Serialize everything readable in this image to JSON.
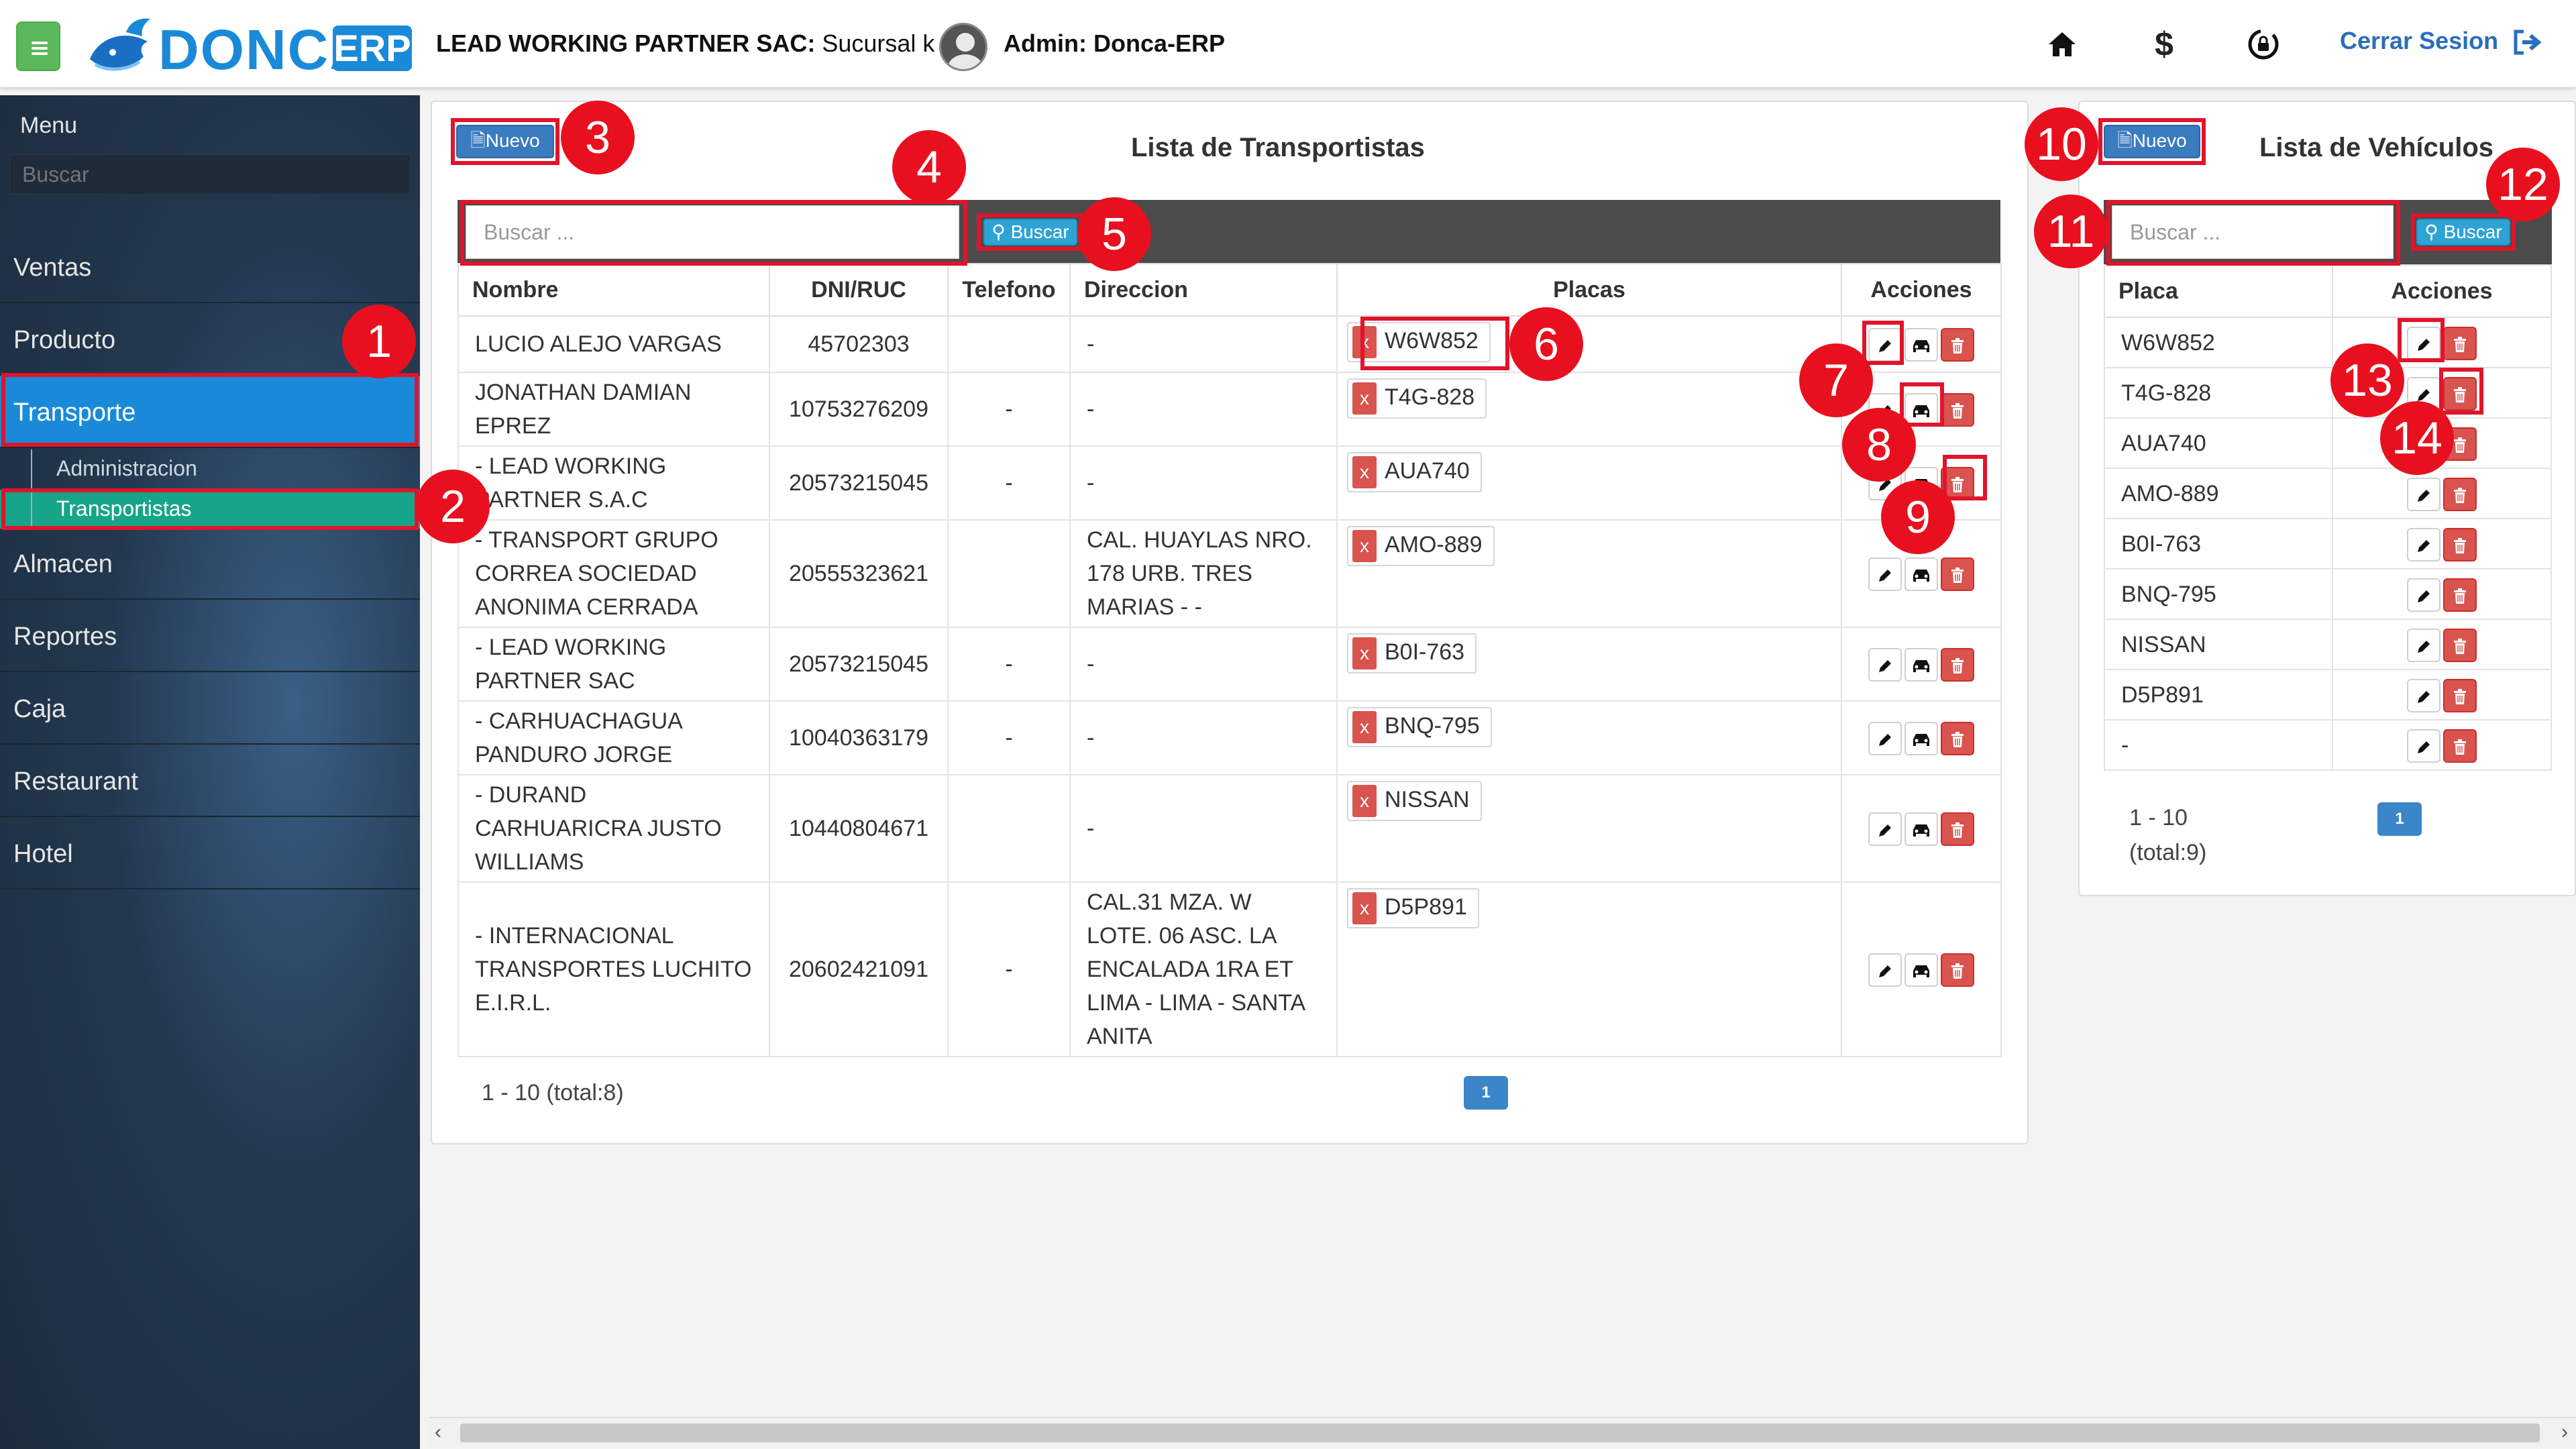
{
  "header": {
    "logo_word": "DONCA",
    "logo_badge": "ERP",
    "company_bold": "LEAD WORKING PARTNER SAC:",
    "company_rest": " Sucursal k |",
    "admin": "Admin: Donca-ERP",
    "logout": "Cerrar Sesion"
  },
  "sidebar": {
    "title": "Menu",
    "search_placeholder": "Buscar",
    "items": [
      "Ventas",
      "Producto",
      "Transporte",
      "Almacen",
      "Reportes",
      "Caja",
      "Restaurant",
      "Hotel"
    ],
    "subitems": [
      "Administracion",
      "Transportistas"
    ]
  },
  "transportistas": {
    "new_label": "Nuevo",
    "title": "Lista de Transportistas",
    "search_placeholder": "Buscar ...",
    "search_label": "Buscar",
    "columns": [
      "Nombre",
      "DNI/RUC",
      "Telefono",
      "Direccion",
      "Placas",
      "Acciones"
    ],
    "rows": [
      {
        "nombre": "LUCIO ALEJO VARGAS",
        "dni": "45702303",
        "tel": "",
        "dir": "-",
        "placa": "W6W852"
      },
      {
        "nombre": "JONATHAN DAMIAN EPREZ",
        "dni": "10753276209",
        "tel": "-",
        "dir": "-",
        "placa": "T4G-828"
      },
      {
        "nombre": "- LEAD WORKING PARTNER S.A.C",
        "dni": "20573215045",
        "tel": "-",
        "dir": "-",
        "placa": "AUA740"
      },
      {
        "nombre": "- TRANSPORT GRUPO CORREA SOCIEDAD ANONIMA CERRADA",
        "dni": "20555323621",
        "tel": "",
        "dir": "CAL. HUAYLAS NRO. 178 URB. TRES MARIAS - -",
        "placa": "AMO-889"
      },
      {
        "nombre": "- LEAD WORKING PARTNER SAC",
        "dni": "20573215045",
        "tel": "-",
        "dir": "-",
        "placa": "B0I-763"
      },
      {
        "nombre": "- CARHUACHAGUA PANDURO JORGE",
        "dni": "10040363179",
        "tel": "-",
        "dir": "-",
        "placa": "BNQ-795"
      },
      {
        "nombre": "- DURAND CARHUARICRA JUSTO WILLIAMS",
        "dni": "10440804671",
        "tel": "",
        "dir": "-",
        "placa": "NISSAN"
      },
      {
        "nombre": "- INTERNACIONAL TRANSPORTES LUCHITO E.I.R.L.",
        "dni": "20602421091",
        "tel": "-",
        "dir": "CAL.31 MZA. W LOTE. 06 ASC. LA ENCALADA 1RA ET LIMA - LIMA - SANTA ANITA",
        "placa": "D5P891"
      }
    ],
    "pager_text": "1 - 10 (total:8)",
    "page": "1"
  },
  "vehiculos": {
    "new_label": "Nuevo",
    "title": "Lista de Vehículos",
    "search_placeholder": "Buscar ...",
    "search_label": "Buscar",
    "columns": [
      "Placa",
      "Acciones"
    ],
    "rows": [
      "W6W852",
      "T4G-828",
      "AUA740",
      "AMO-889",
      "B0I-763",
      "BNQ-795",
      "NISSAN",
      "D5P891",
      "-"
    ],
    "pager_range": "1 - 10",
    "pager_total": "(total:9)",
    "page": "1"
  },
  "annotations": [
    "1",
    "2",
    "3",
    "4",
    "5",
    "6",
    "7",
    "8",
    "9",
    "10",
    "11",
    "12",
    "13",
    "14"
  ],
  "colors": {
    "accent": "#1a8ad8",
    "active_sub": "#17a589",
    "danger": "#d9534f",
    "annotation": "#e8101e",
    "menu_toggle": "#5cb85c"
  }
}
